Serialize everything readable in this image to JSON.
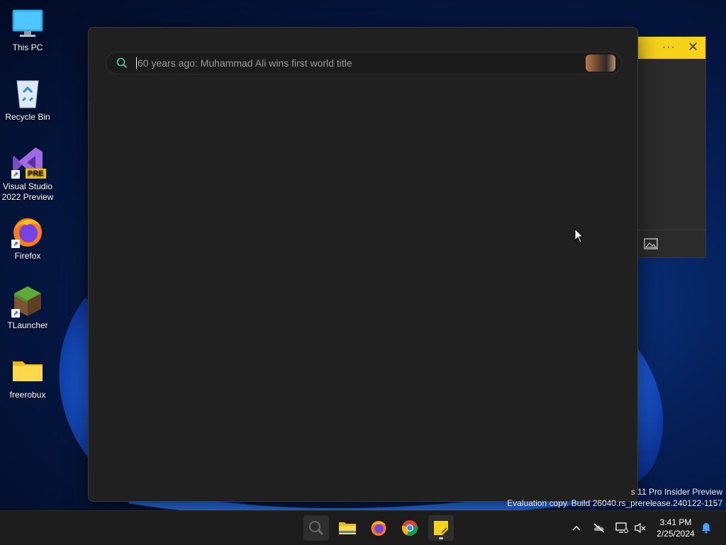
{
  "desktop": {
    "icons": [
      {
        "label": "This PC",
        "icon": "monitor-icon"
      },
      {
        "label": "Recycle Bin",
        "icon": "recycle-bin-icon"
      },
      {
        "label": "Visual Studio 2022 Preview",
        "icon": "visual-studio-preview-icon",
        "badge": "PRE"
      },
      {
        "label": "Firefox",
        "icon": "firefox-icon"
      },
      {
        "label": "TLauncher",
        "icon": "grass-block-icon"
      },
      {
        "label": "freerobux",
        "icon": "folder-icon"
      }
    ]
  },
  "search": {
    "placeholder": "60 years ago: Muhammad Ali wins first world title",
    "value": ""
  },
  "watermark": {
    "line1": "s 11 Pro Insider Preview",
    "line2": "Evaluation copy. Build 26040.rs_prerelease.240122-1157"
  },
  "taskbar": {
    "apps": [
      {
        "name": "search",
        "icon": "search-icon"
      },
      {
        "name": "file-explorer",
        "icon": "folder-icon"
      },
      {
        "name": "firefox",
        "icon": "firefox-icon"
      },
      {
        "name": "chrome",
        "icon": "chrome-icon"
      },
      {
        "name": "sticky-notes",
        "icon": "sticky-notes-icon"
      }
    ],
    "time": "3:41 PM",
    "date": "2/25/2024"
  },
  "colors": {
    "sticky_header": "#f7d21a",
    "accent_search_icon": "#4ec9a0"
  }
}
